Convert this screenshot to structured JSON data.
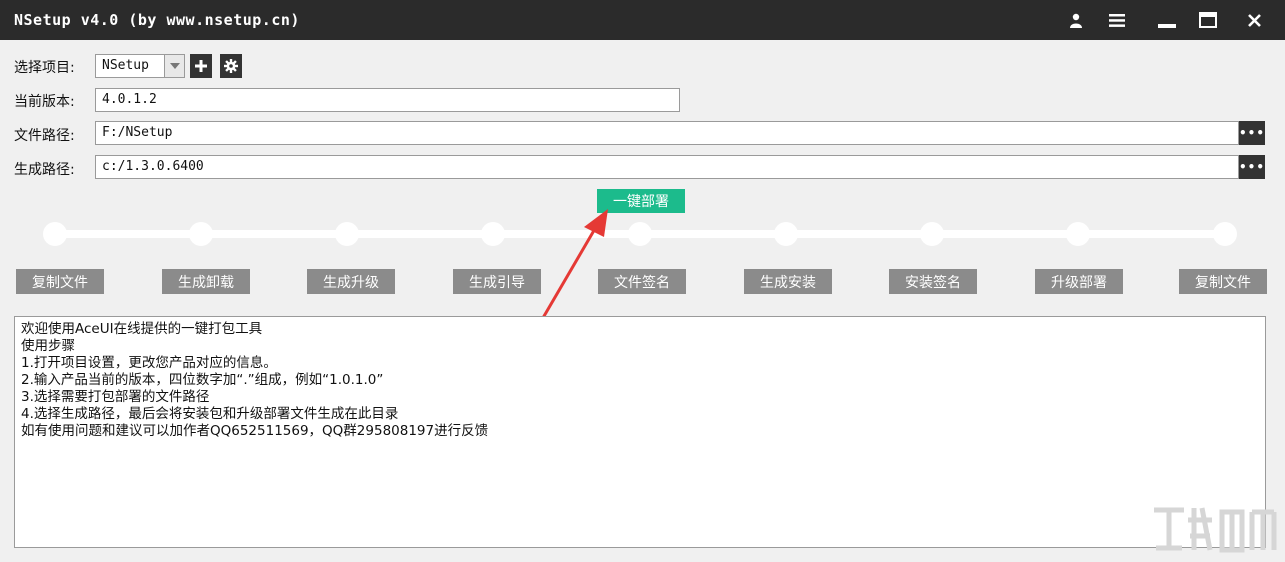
{
  "window": {
    "title": "NSetup v4.0 (by www.nsetup.cn)",
    "buttons": [
      "user-icon",
      "menu-icon",
      "minimize-icon",
      "maximize-icon",
      "close-icon"
    ]
  },
  "form": {
    "project_label": "选择项目:",
    "project_value": "NSetup",
    "version_label": "当前版本:",
    "version_value": "4.0.1.2",
    "filepath_label": "文件路径:",
    "filepath_value": "F:/NSetup",
    "outpath_label": "生成路径:",
    "outpath_value": "c:/1.3.0.6400",
    "browse_label": "•••"
  },
  "deploy_button": "一键部署",
  "steps": [
    "复制文件",
    "生成卸载",
    "生成升级",
    "生成引导",
    "文件签名",
    "生成安装",
    "安装签名",
    "升级部署",
    "复制文件"
  ],
  "log_lines": [
    "欢迎使用AceUI在线提供的一键打包工具",
    "使用步骤",
    "1.打开项目设置，更改您产品对应的信息。",
    "2.输入产品当前的版本，四位数字加“.”组成，例如“1.0.1.0”",
    "3.选择需要打包部署的文件路径",
    "4.选择生成路径，最后会将安装包和升级部署文件生成在此目录",
    "如有使用问题和建议可以加作者QQ652511569，QQ群295808197进行反馈"
  ],
  "colors": {
    "titlebar": "#2b2b2b",
    "accent": "#1cbb8c",
    "step_button": "#8b8b8b",
    "annotation_arrow": "#e53935"
  }
}
